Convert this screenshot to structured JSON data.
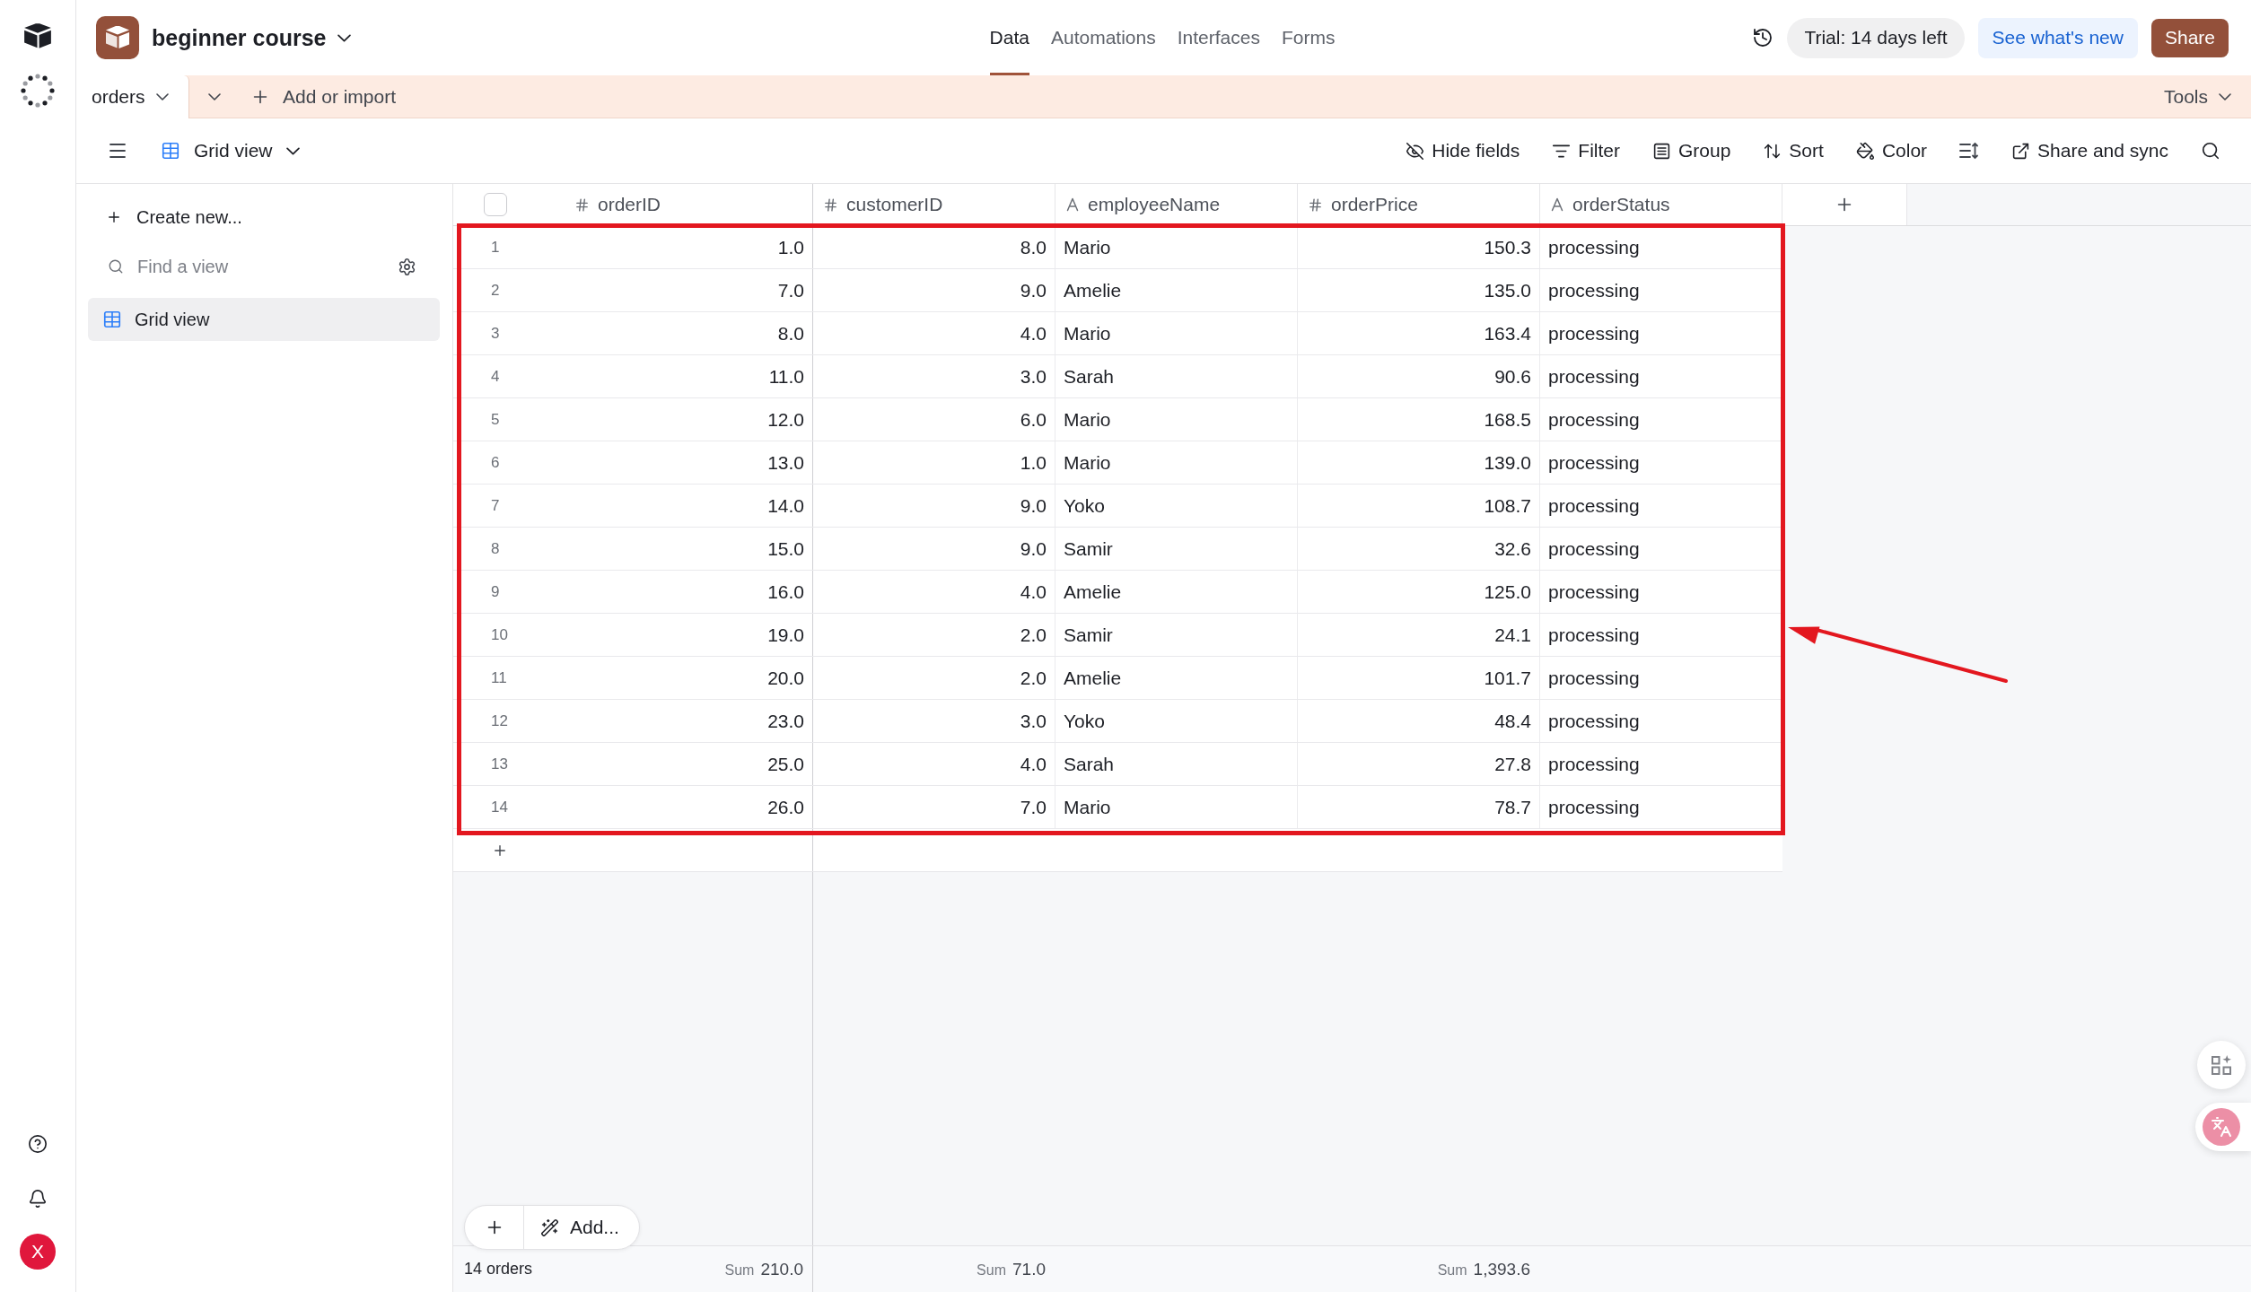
{
  "rail": {
    "user_initial": "X"
  },
  "header": {
    "base_name": "beginner course",
    "nav_tabs": [
      {
        "label": "Data",
        "selected": true
      },
      {
        "label": "Automations",
        "selected": false
      },
      {
        "label": "Interfaces",
        "selected": false
      },
      {
        "label": "Forms",
        "selected": false
      }
    ],
    "trial": "Trial: 14 days left",
    "whats_new": "See what's new",
    "share": "Share"
  },
  "tab_bar": {
    "tables": [
      {
        "label": "orders",
        "selected": true
      }
    ],
    "add_or_import": "Add or import",
    "tools": "Tools"
  },
  "view_bar": {
    "view_name": "Grid view",
    "hide_fields": "Hide fields",
    "filter": "Filter",
    "group": "Group",
    "sort": "Sort",
    "row_tint_menu": "Color",
    "share_and_sync": "Share and sync"
  },
  "sidebar": {
    "create_new": "Create new...",
    "search": {
      "placeholder": "Find a view"
    },
    "views": [
      {
        "name": "Grid view",
        "selected": true
      }
    ]
  },
  "table": {
    "select_all_checked": false,
    "columns": [
      {
        "name": "orderID",
        "kind": "number"
      },
      {
        "name": "customerID",
        "kind": "number"
      },
      {
        "name": "employeeName",
        "kind": "text"
      },
      {
        "name": "orderPrice",
        "kind": "number"
      },
      {
        "name": "orderStatus",
        "kind": "text"
      }
    ],
    "rows": [
      {
        "number": "1",
        "cells": [
          "1.0",
          "8.0",
          "Mario",
          "150.3",
          "processing"
        ]
      },
      {
        "number": "2",
        "cells": [
          "7.0",
          "9.0",
          "Amelie",
          "135.0",
          "processing"
        ]
      },
      {
        "number": "3",
        "cells": [
          "8.0",
          "4.0",
          "Mario",
          "163.4",
          "processing"
        ]
      },
      {
        "number": "4",
        "cells": [
          "11.0",
          "3.0",
          "Sarah",
          "90.6",
          "processing"
        ]
      },
      {
        "number": "5",
        "cells": [
          "12.0",
          "6.0",
          "Mario",
          "168.5",
          "processing"
        ]
      },
      {
        "number": "6",
        "cells": [
          "13.0",
          "1.0",
          "Mario",
          "139.0",
          "processing"
        ]
      },
      {
        "number": "7",
        "cells": [
          "14.0",
          "9.0",
          "Yoko",
          "108.7",
          "processing"
        ]
      },
      {
        "number": "8",
        "cells": [
          "15.0",
          "9.0",
          "Samir",
          "32.6",
          "processing"
        ]
      },
      {
        "number": "9",
        "cells": [
          "16.0",
          "4.0",
          "Amelie",
          "125.0",
          "processing"
        ]
      },
      {
        "number": "10",
        "cells": [
          "19.0",
          "2.0",
          "Samir",
          "24.1",
          "processing"
        ]
      },
      {
        "number": "11",
        "cells": [
          "20.0",
          "2.0",
          "Amelie",
          "101.7",
          "processing"
        ]
      },
      {
        "number": "12",
        "cells": [
          "23.0",
          "3.0",
          "Yoko",
          "48.4",
          "processing"
        ]
      },
      {
        "number": "13",
        "cells": [
          "25.0",
          "4.0",
          "Sarah",
          "27.8",
          "processing"
        ]
      },
      {
        "number": "14",
        "cells": [
          "26.0",
          "7.0",
          "Mario",
          "78.7",
          "processing"
        ]
      }
    ]
  },
  "add_bar": {
    "label": "Add..."
  },
  "footer": {
    "record_count": "14 orders",
    "summaries": [
      {
        "kind": "sum",
        "label": "Sum",
        "value": "210.0"
      },
      {
        "kind": "sum",
        "label": "Sum",
        "value": "71.0"
      },
      {
        "kind": "empty"
      },
      {
        "kind": "sum",
        "label": "Sum",
        "value": "1,393.6"
      },
      {
        "kind": "empty"
      }
    ]
  }
}
